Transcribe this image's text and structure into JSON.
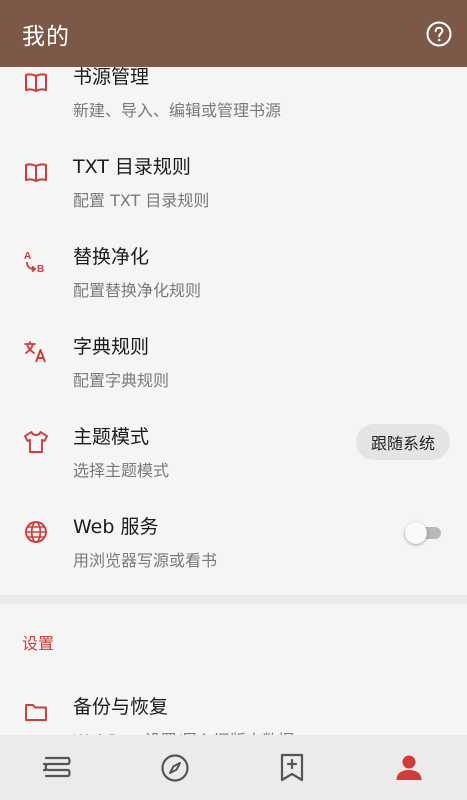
{
  "appbar": {
    "title": "我的",
    "help_icon": "help-circle-icon"
  },
  "colors": {
    "appbar": "#7b5848",
    "accent": "#d33a3a",
    "background": "#f5f5f5",
    "bottom_nav": "#ebebeb"
  },
  "items": [
    {
      "title": "书源管理",
      "subtitle": "新建、导入、编辑或管理书源",
      "icon": "book-open-icon"
    },
    {
      "title": "TXT 目录规则",
      "subtitle": "配置 TXT 目录规则",
      "icon": "book-open-icon"
    },
    {
      "title": "替换净化",
      "subtitle": "配置替换净化规则",
      "icon": "replace-ab-icon"
    },
    {
      "title": "字典规则",
      "subtitle": "配置字典规则",
      "icon": "translate-icon"
    },
    {
      "title": "主题模式",
      "subtitle": "选择主题模式",
      "icon": "tshirt-icon",
      "value": "跟随系统"
    },
    {
      "title": "Web 服务",
      "subtitle": "用浏览器写源或看书",
      "icon": "globe-icon",
      "toggle_on": false
    }
  ],
  "settings": {
    "header": "设置",
    "items": [
      {
        "title": "备份与恢复",
        "subtitle": "WebDav 设置/导入旧版本数据",
        "icon": "folder-icon"
      }
    ]
  },
  "bottom_nav": [
    {
      "name": "bookshelf",
      "icon": "bookshelf-icon",
      "active": false
    },
    {
      "name": "discover",
      "icon": "compass-icon",
      "active": false
    },
    {
      "name": "rss",
      "icon": "bookmark-add-icon",
      "active": false
    },
    {
      "name": "my",
      "icon": "person-icon",
      "active": true
    }
  ]
}
